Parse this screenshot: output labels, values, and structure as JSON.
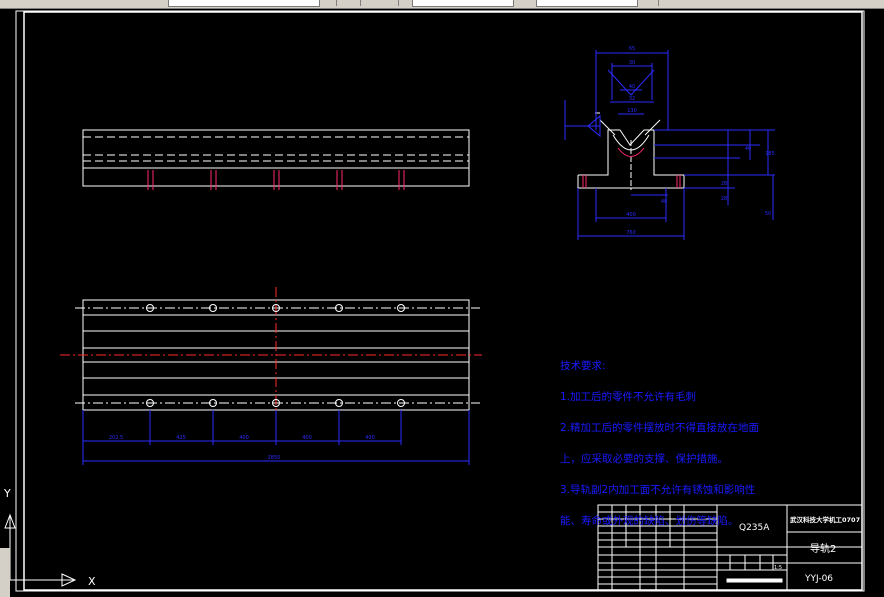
{
  "toolbar": {
    "fields": [
      "",
      "",
      ""
    ]
  },
  "drawing": {
    "side_view_dims": [
      "202.5",
      "425",
      "400",
      "400",
      "400",
      "2850"
    ],
    "section_dims_top": [
      "65",
      "30",
      "40",
      "32",
      "130"
    ],
    "section_dims_right": [
      "40",
      "185",
      "28",
      "28",
      "50"
    ],
    "section_dims_bottom": [
      "40",
      "400",
      "760"
    ]
  },
  "notes": {
    "title": "技术要求:",
    "lines": [
      "1.加工后的零件不允许有毛刺",
      "2.精加工后的零件摆放时不得直接放在地面",
      "上，应采取必要的支撑、保护措施。",
      "3.导轨副2内加工面不允许有锈蚀和影响性",
      "能、寿命或外观的缺陷、划伤等缺陷。"
    ]
  },
  "title_block": {
    "material": "Q235A",
    "school": "武汉科技大学机工0707",
    "part_name": "导轨2",
    "drawing_no": "YYJ-06",
    "scale": "1:5"
  },
  "ucs": {
    "x_label": "X",
    "y_label": "Y"
  },
  "colors": {
    "background": "#000000",
    "lines": "#ffffff",
    "dims": "#2b2bff",
    "center": "#ff2a2a",
    "holes": "#ff2a6a"
  }
}
